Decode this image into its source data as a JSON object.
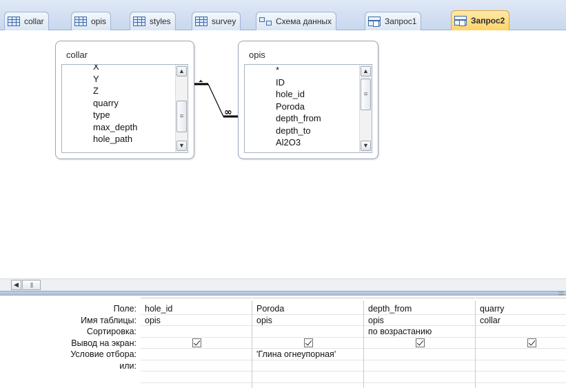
{
  "tabs": [
    {
      "label": "collar",
      "icon": "table-icon",
      "active": false
    },
    {
      "label": "opis",
      "icon": "table-icon",
      "active": false
    },
    {
      "label": "styles",
      "icon": "table-icon",
      "active": false
    },
    {
      "label": "survey",
      "icon": "table-icon",
      "active": false
    },
    {
      "label": "Схема данных",
      "icon": "relationships-icon",
      "active": false
    },
    {
      "label": "Запрос1",
      "icon": "query-icon",
      "active": false
    },
    {
      "label": "Запрос2",
      "icon": "query-icon",
      "active": true
    }
  ],
  "field_lists": {
    "collar": {
      "title": "collar",
      "fields": [
        "X",
        "Y",
        "Z",
        "quarry",
        "type",
        "max_depth",
        "hole_path"
      ]
    },
    "opis": {
      "title": "opis",
      "fields": [
        "*",
        "ID",
        "hole_id",
        "Poroda",
        "depth_from",
        "depth_to",
        "Al2O3"
      ]
    }
  },
  "relationship": {
    "one_side_label": "1",
    "many_side_label": "∞"
  },
  "qbe_grid": {
    "row_labels": {
      "field": "Поле:",
      "table": "Имя таблицы:",
      "sort": "Сортировка:",
      "show": "Вывод на экран:",
      "criteria": "Условие отбора:",
      "or": "или:"
    },
    "columns": [
      {
        "field": "hole_id",
        "table": "opis",
        "sort": "",
        "show": true,
        "criteria": "",
        "or": ""
      },
      {
        "field": "Poroda",
        "table": "opis",
        "sort": "",
        "show": true,
        "criteria": "'Глина огнеупорная'",
        "or": ""
      },
      {
        "field": "depth_from",
        "table": "opis",
        "sort": "по возрастанию",
        "show": true,
        "criteria": "",
        "or": ""
      },
      {
        "field": "quarry",
        "table": "collar",
        "sort": "",
        "show": true,
        "criteria": "",
        "or": ""
      }
    ]
  },
  "colors": {
    "active_tab": "#ffd36a",
    "tab_strip": "#c9d8ee",
    "splitter": "#9fb3cf"
  }
}
